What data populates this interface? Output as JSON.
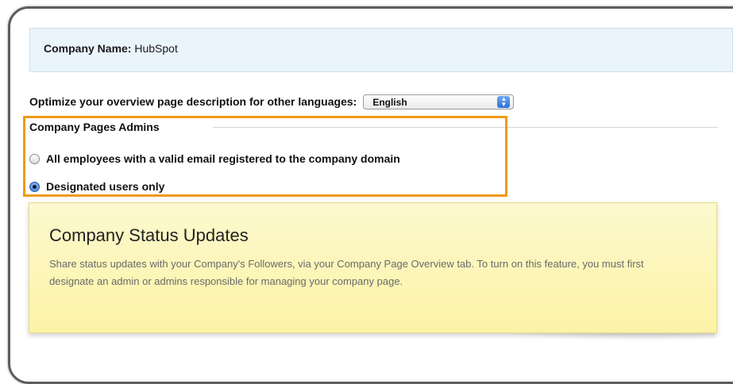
{
  "company": {
    "label": "Company Name:",
    "value": "HubSpot"
  },
  "language": {
    "label": "Optimize your overview page description for other languages:",
    "selected": "English"
  },
  "admins": {
    "title": "Company Pages Admins",
    "options": [
      {
        "label": "All employees with a valid email registered to the company domain",
        "checked": false
      },
      {
        "label": "Designated users only",
        "checked": true
      }
    ]
  },
  "status_updates": {
    "title": "Company Status Updates",
    "body": "Share status updates with your Company's Followers, via your Company Page Overview tab. To turn on this feature, you must first designate an admin or admins responsible for managing your company page."
  },
  "colors": {
    "highlight": "#ef9a13",
    "info_box": "#eaf4fb",
    "note": "#fbf3a5"
  }
}
